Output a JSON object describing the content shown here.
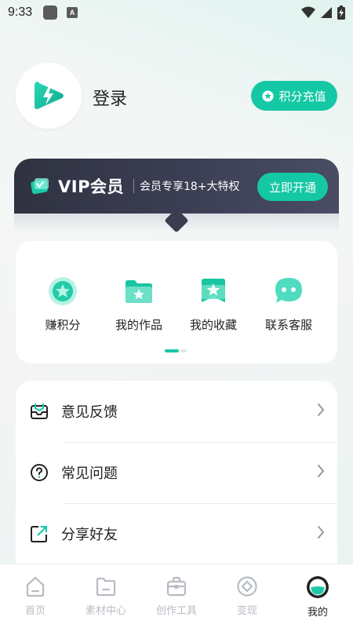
{
  "status_bar": {
    "time": "9:33",
    "a_badge": "A"
  },
  "profile": {
    "login_text": "登录",
    "points_button_label": "积分充值"
  },
  "vip": {
    "title": "VIP会员",
    "description": "会员专享18+大特权",
    "button_label": "立即开通"
  },
  "quick_actions": [
    {
      "label": "赚积分",
      "icon": "star-badge-icon"
    },
    {
      "label": "我的作品",
      "icon": "folder-star-icon"
    },
    {
      "label": "我的收藏",
      "icon": "favorites-star-icon"
    },
    {
      "label": "联系客服",
      "icon": "chat-bubble-icon"
    }
  ],
  "quick_page_indicator": {
    "current": 1,
    "total": 2
  },
  "menu": [
    {
      "label": "意见反馈",
      "icon": "feedback-icon"
    },
    {
      "label": "常见问题",
      "icon": "question-icon"
    },
    {
      "label": "分享好友",
      "icon": "share-icon"
    }
  ],
  "bottom_nav": [
    {
      "label": "首页",
      "icon": "home-icon",
      "active": false
    },
    {
      "label": "素材中心",
      "icon": "folder-icon",
      "active": false
    },
    {
      "label": "创作工具",
      "icon": "toolbox-icon",
      "active": false
    },
    {
      "label": "变现",
      "icon": "diamond-icon",
      "active": false
    },
    {
      "label": "我的",
      "icon": "profile-face-icon",
      "active": true
    }
  ],
  "colors": {
    "accent": "#15c8a5",
    "vip_background": "#353849",
    "inactive_nav": "#b7bcc3"
  }
}
